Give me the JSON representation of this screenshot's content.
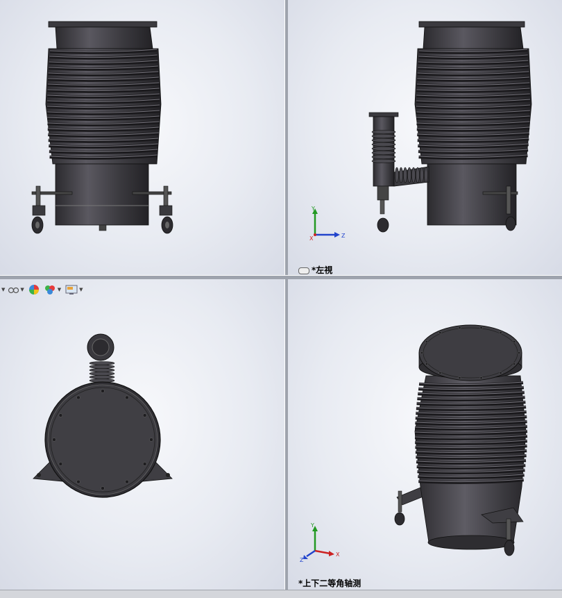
{
  "viewports": {
    "front": {
      "label": ""
    },
    "left": {
      "label": "*左視"
    },
    "top": {
      "label": ""
    },
    "iso": {
      "label": "*上下二等角轴测"
    }
  },
  "triad": {
    "x": "X",
    "y": "Y",
    "z": "Z"
  },
  "toolbar": {
    "buttons": [
      "view-orientation",
      "display-style",
      "appearance",
      "scene",
      "view-settings"
    ]
  },
  "colors": {
    "axis_x": "#cc2222",
    "axis_y": "#229922",
    "axis_z": "#2244cc",
    "model": "#3a393d"
  }
}
